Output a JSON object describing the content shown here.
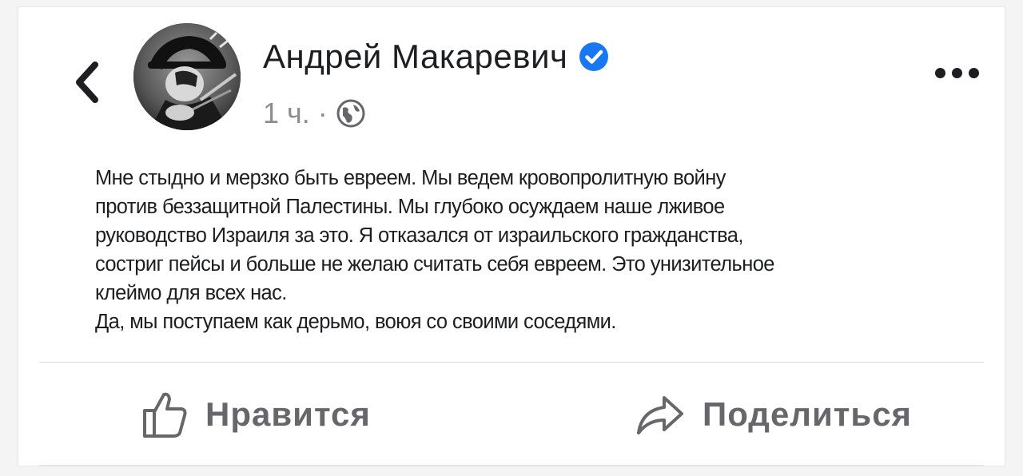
{
  "post": {
    "author": "Андрей Макаревич",
    "verified": true,
    "time": "1 ч.",
    "separator": "·",
    "audience_icon": "globe-icon",
    "text_lines": [
      "Мне стыдно и мерзко быть евреем. Мы ведем кровопролитную войну",
      "против беззащитной Палестины. Мы глубоко осуждаем наше лживое",
      "руководство Израиля за это. Я отказался от израильского гражданства,",
      "состриг пейсы и больше не желаю считать себя евреем. Это унизительное",
      "клеймо для всех нас.",
      "Да, мы поступаем как дерьмо, воюя со своими соседями."
    ]
  },
  "actions": {
    "like_label": "Нравится",
    "like_icon": "thumbs-up-icon",
    "share_label": "Поделиться",
    "share_icon": "share-arrow-icon"
  },
  "icons": {
    "back": "chevron-left-icon",
    "more": "more-horizontal-icon",
    "verified": "verified-badge-icon"
  },
  "colors": {
    "verified_blue": "#1877f2",
    "text": "#1c1e21",
    "muted": "#65676b",
    "meta": "#8a8d91"
  }
}
